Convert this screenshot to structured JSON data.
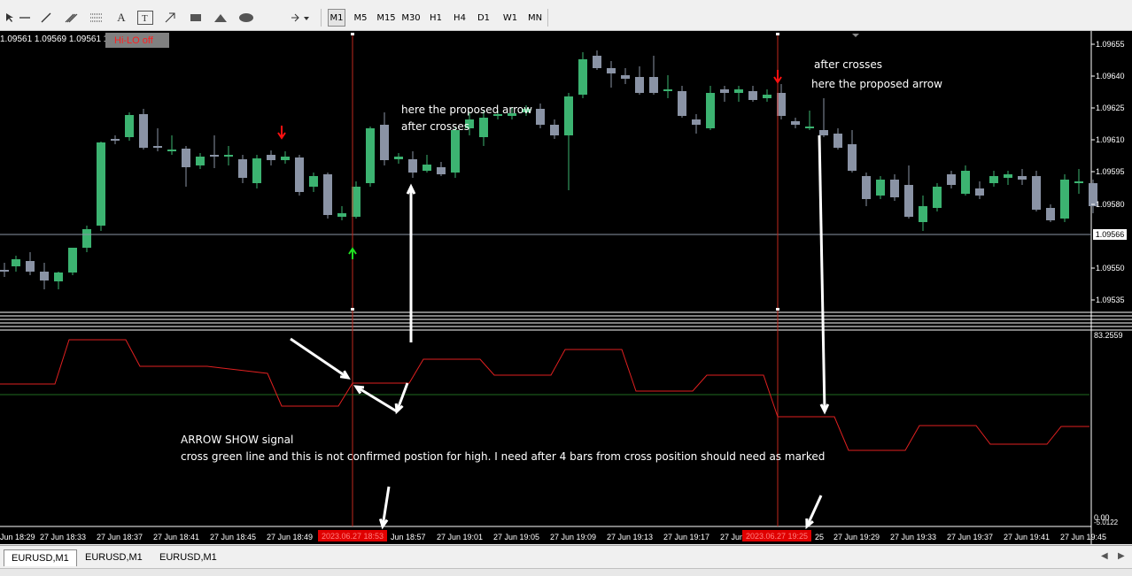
{
  "toolbar": {
    "tools": [
      "cursor-icon",
      "horizontal-line-icon",
      "trendline-icon",
      "channel-icon",
      "fibonacci-icon",
      "text-icon",
      "text-label-icon",
      "arrow-tool-icon",
      "rectangle-icon",
      "triangle-icon",
      "ellipse-icon",
      "arrow-shapes-icon"
    ],
    "text_tool": "A",
    "timeframes": [
      "M1",
      "M5",
      "M15",
      "M30",
      "H1",
      "H4",
      "D1",
      "W1",
      "MN"
    ],
    "active_timeframe": "M1"
  },
  "chart": {
    "ohlc_header": "1.09561 1.09569 1.09561 1.09",
    "hilo_button": "Hi-LO off",
    "price_labels": [
      "1.09655",
      "1.09640",
      "1.09625",
      "1.09610",
      "1.09595",
      "1.09580",
      "1.09550",
      "1.09535"
    ],
    "current_price": "1.09566",
    "indicator_max": "83.2559",
    "indicator_min": "0.00",
    "indicator_min2": "-5.0122",
    "time_labels": [
      "Jun 18:29",
      "27 Jun 18:33",
      "27 Jun 18:37",
      "27 Jun 18:41",
      "27 Jun 18:45",
      "27 Jun 18:49",
      "Jun 18:57",
      "27 Jun 19:01",
      "27 Jun 19:05",
      "27 Jun 19:09",
      "27 Jun 19:13",
      "27 Jun 19:17",
      "27 Jun 19:21",
      "25",
      "27 Jun 19:29",
      "27 Jun 19:33",
      "27 Jun 19:37",
      "27 Jun 19:41",
      "27 Jun 19:45"
    ],
    "time_marker_1": "2023.06.27 18:53",
    "time_marker_2": "2023.06.27 19:25",
    "annotations": {
      "proposed_1_line1": "here the proposed arrow",
      "proposed_1_line2": "after crosses",
      "proposed_2_line1": "after crosses",
      "proposed_2_line2": "here the proposed arrow",
      "signal_title": "ARROW SHOW signal",
      "signal_desc": "cross green line and this is not confirmed postion for high. I need after 4 bars from cross position should need as marked"
    },
    "colors": {
      "bull": "#3cb371",
      "bear": "#8a93a5",
      "indicator": "#e02020",
      "signal_line": "#1f6b1f",
      "vline": "#c0281e",
      "annotation": "#ffffff"
    }
  },
  "tabs": [
    "EURUSD,M1",
    "EURUSD,M1",
    "EURUSD,M1"
  ],
  "active_tab": 0
}
